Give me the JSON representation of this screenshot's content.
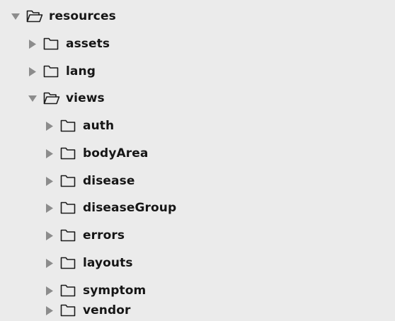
{
  "tree": {
    "root": {
      "label": "resources",
      "expanded": true,
      "icon": "folder-open-icon"
    },
    "assets": {
      "label": "assets",
      "expanded": false,
      "icon": "folder-icon"
    },
    "lang": {
      "label": "lang",
      "expanded": false,
      "icon": "folder-icon"
    },
    "views": {
      "label": "views",
      "expanded": true,
      "icon": "folder-open-icon",
      "children": [
        {
          "label": "auth",
          "expanded": false
        },
        {
          "label": "bodyArea",
          "expanded": false
        },
        {
          "label": "disease",
          "expanded": false
        },
        {
          "label": "diseaseGroup",
          "expanded": false
        },
        {
          "label": "errors",
          "expanded": false
        },
        {
          "label": "layouts",
          "expanded": false
        },
        {
          "label": "symptom",
          "expanded": false
        },
        {
          "label": "vendor",
          "expanded": false
        }
      ]
    }
  },
  "colors": {
    "background": "#ebebeb",
    "arrow": "#8c8c8c",
    "folder_outline": "#1c1c1c",
    "text": "#161616"
  }
}
